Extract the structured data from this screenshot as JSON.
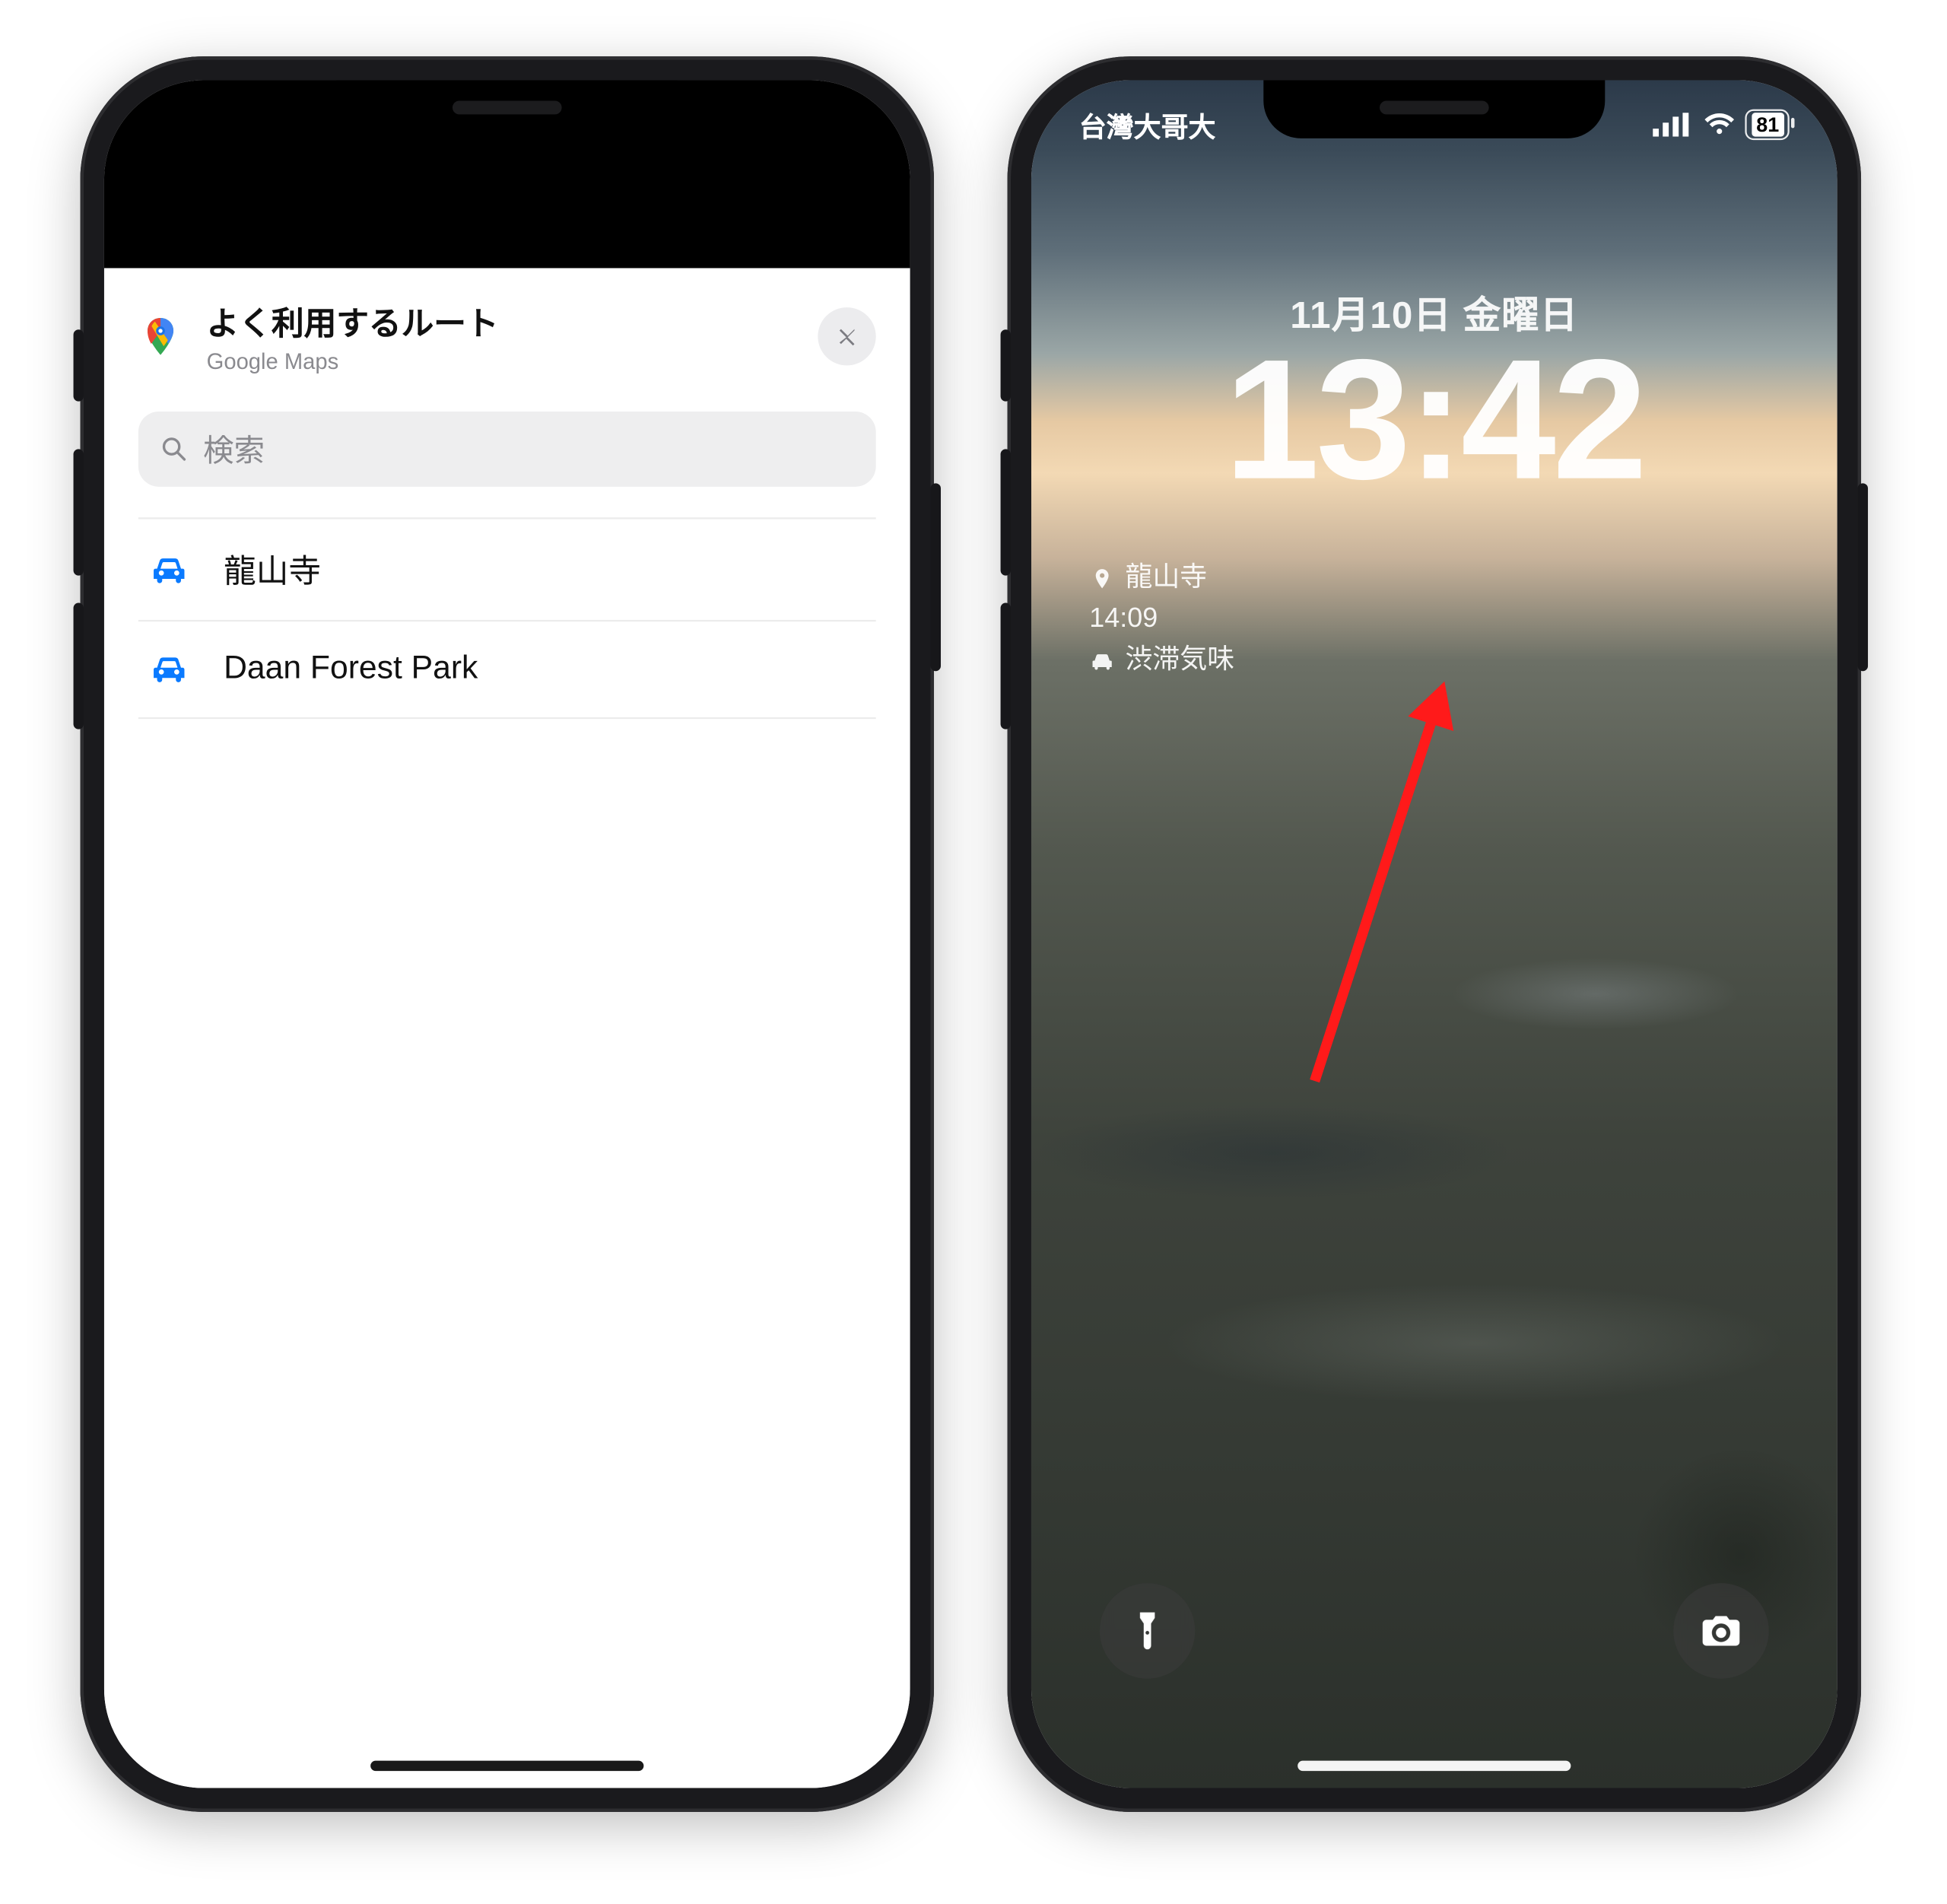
{
  "left_phone": {
    "sheet": {
      "title": "よく利用するルート",
      "subtitle": "Google Maps",
      "search_placeholder": "検索",
      "routes": [
        {
          "label": "龍山寺"
        },
        {
          "label": "Daan Forest Park"
        }
      ]
    }
  },
  "right_phone": {
    "status": {
      "carrier": "台灣大哥大",
      "battery": "81"
    },
    "lock": {
      "date": "11月10日 金曜日",
      "time": "13:42"
    },
    "widget": {
      "place": "龍山寺",
      "eta": "14:09",
      "traffic": "渋滞気味"
    }
  }
}
